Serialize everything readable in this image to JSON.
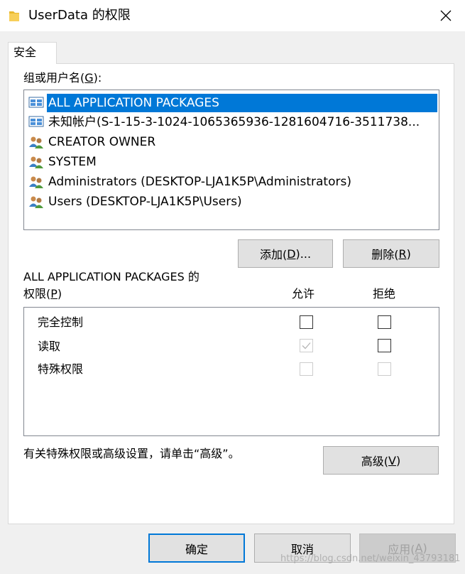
{
  "window": {
    "title": "UserData 的权限",
    "close_glyph": "✕"
  },
  "tabs": [
    {
      "label": "安全"
    }
  ],
  "groups": {
    "label_prefix": "组或用户名(",
    "label_key": "G",
    "label_suffix": "):",
    "items": [
      {
        "name": "ALL APPLICATION PACKAGES",
        "icon": "app-package-icon",
        "selected": true
      },
      {
        "name": "未知帐户(S-1-15-3-1024-1065365936-1281604716-3511738...",
        "icon": "unknown-account-icon",
        "selected": false
      },
      {
        "name": "CREATOR OWNER",
        "icon": "users-group-icon",
        "selected": false
      },
      {
        "name": "SYSTEM",
        "icon": "users-group-icon",
        "selected": false
      },
      {
        "name": "Administrators (DESKTOP-LJA1K5P\\Administrators)",
        "icon": "users-group-icon",
        "selected": false
      },
      {
        "name": "Users (DESKTOP-LJA1K5P\\Users)",
        "icon": "users-group-icon",
        "selected": false
      }
    ]
  },
  "buttons": {
    "add_prefix": "添加(",
    "add_key": "D",
    "add_suffix": ")...",
    "remove_prefix": "删除(",
    "remove_key": "R",
    "remove_suffix": ")",
    "advanced_prefix": "高级(",
    "advanced_key": "V",
    "advanced_suffix": ")",
    "ok": "确定",
    "cancel": "取消",
    "apply_prefix": "应用(",
    "apply_key": "A",
    "apply_suffix": ")"
  },
  "permissions": {
    "header_line1": "ALL APPLICATION PACKAGES 的",
    "header_prefix": "权限(",
    "header_key": "P",
    "header_suffix": ")",
    "allow_label": "允许",
    "deny_label": "拒绝",
    "rows": [
      {
        "name": "完全控制",
        "allow": false,
        "allow_disabled": false,
        "deny": false,
        "deny_disabled": false
      },
      {
        "name": "读取",
        "allow": true,
        "allow_disabled": true,
        "deny": false,
        "deny_disabled": false
      },
      {
        "name": "特殊权限",
        "allow": false,
        "allow_disabled": true,
        "deny": false,
        "deny_disabled": true
      }
    ]
  },
  "advanced_note": "有关特殊权限或高级设置，请单击“高级”。",
  "watermark": "https://blog.csdn.net/weixin_43793181",
  "colors": {
    "selection": "#0078d7",
    "dialog_bg": "#f0f0f0",
    "button_bg": "#e1e1e1"
  }
}
